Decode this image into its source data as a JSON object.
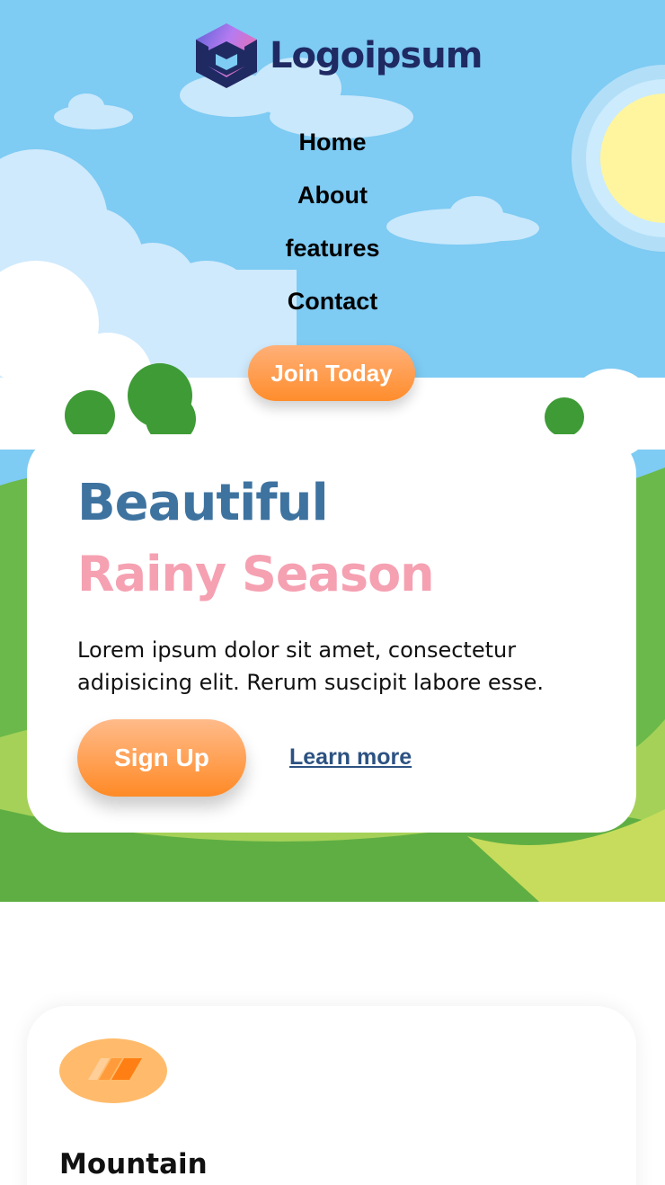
{
  "brand": {
    "name": "Logoipsum"
  },
  "nav": {
    "items": [
      {
        "label": "Home"
      },
      {
        "label": "About"
      },
      {
        "label": "features"
      },
      {
        "label": "Contact"
      }
    ],
    "cta_label": "Join Today"
  },
  "hero": {
    "title_line1": "Beautiful",
    "title_line2": "Rainy Season",
    "description": "Lorem ipsum dolor sit amet, consectetur adipisicing elit. Rerum suscipit labore esse.",
    "primary_label": "Sign Up",
    "secondary_label": "Learn more"
  },
  "features": {
    "items": [
      {
        "title": "Mountain",
        "icon": "mountain-icon"
      }
    ]
  },
  "colors": {
    "sky": "#7ecbf3",
    "grass": "#6bb94a",
    "accent_orange": "#ff8d2c",
    "title_blue": "#3e73a0",
    "title_pink": "#f5a1b2",
    "brand_navy": "#1f2a63"
  }
}
